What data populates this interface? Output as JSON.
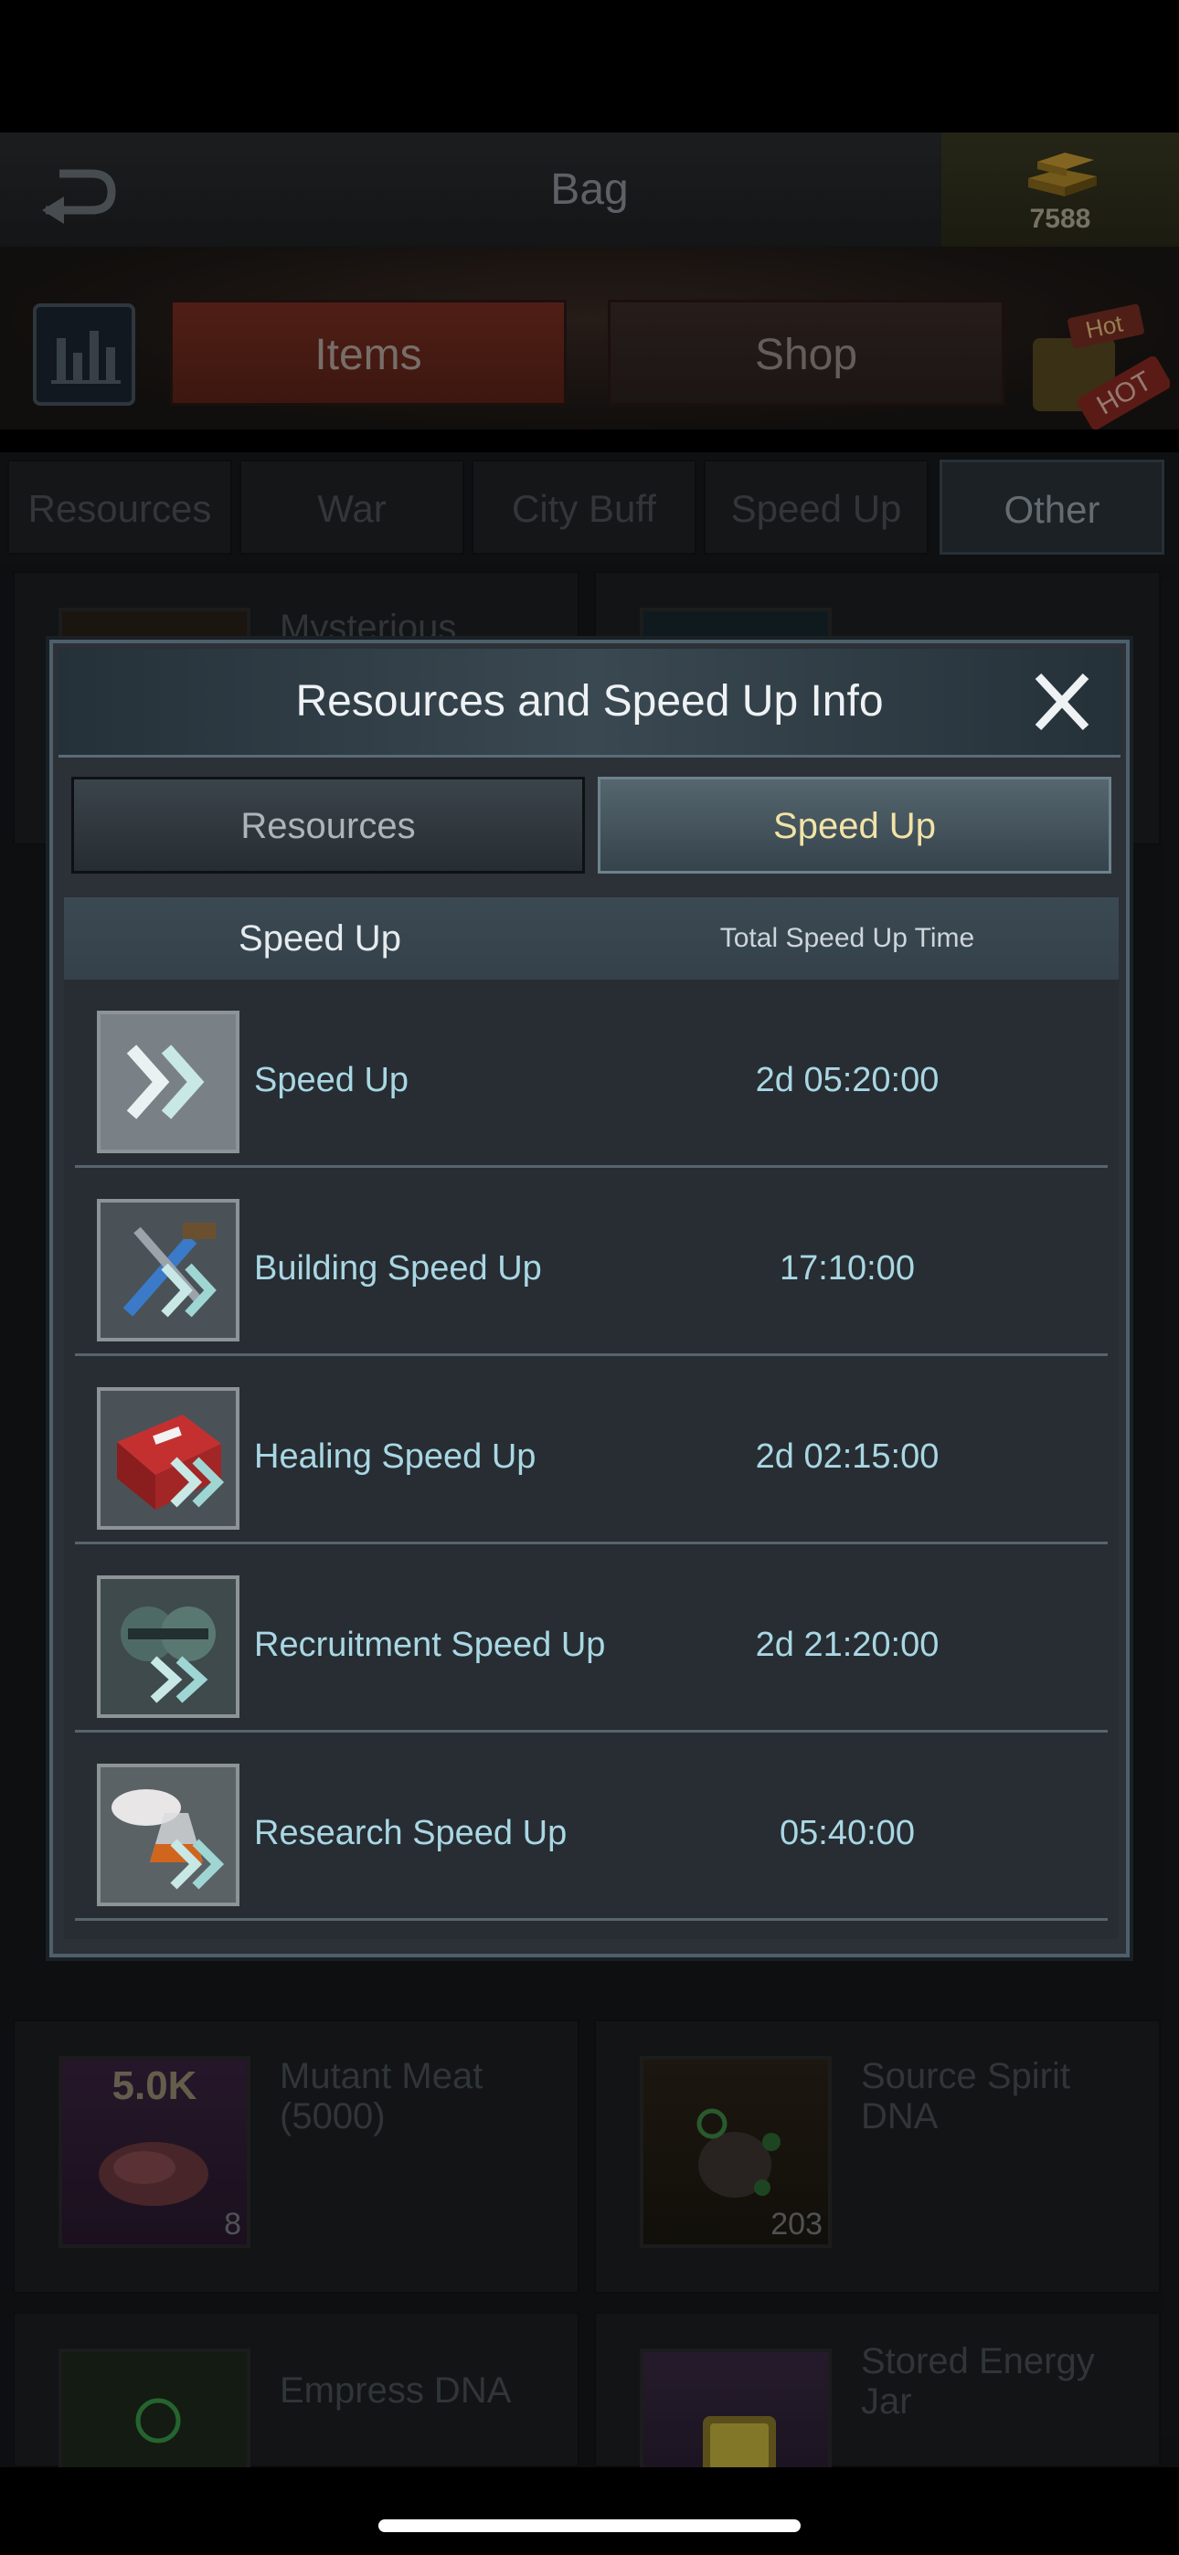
{
  "header": {
    "title": "Bag",
    "gold": "7588"
  },
  "main_tabs": [
    {
      "label": "Items"
    },
    {
      "label": "Shop"
    }
  ],
  "hot_badge": [
    "Hot",
    "HOT"
  ],
  "sub_tabs": [
    {
      "label": "Resources"
    },
    {
      "label": "War"
    },
    {
      "label": "City Buff"
    },
    {
      "label": "Speed Up"
    },
    {
      "label": "Other"
    }
  ],
  "items": [
    {
      "name": "Mysterious",
      "count": "",
      "qty_label": ""
    },
    {
      "name": "Mutant Meat (5000)",
      "count": "8",
      "qty_label": "5.0K"
    },
    {
      "name": "Source Spirit DNA",
      "count": "203",
      "qty_label": ""
    },
    {
      "name": "Empress DNA",
      "count": "",
      "qty_label": ""
    },
    {
      "name": "Stored Energy Jar",
      "count": "",
      "qty_label": ""
    }
  ],
  "modal": {
    "title": "Resources and Speed Up Info",
    "tabs": [
      {
        "label": "Resources"
      },
      {
        "label": "Speed Up"
      }
    ],
    "active_tab": "Speed Up",
    "columns": [
      "Speed Up",
      "Total Speed Up Time"
    ],
    "rows": [
      {
        "label": "Speed Up",
        "time": "2d 05:20:00",
        "icon": "speed-up-icon"
      },
      {
        "label": "Building Speed Up",
        "time": "17:10:00",
        "icon": "building-speed-up-icon"
      },
      {
        "label": "Healing Speed Up",
        "time": "2d 02:15:00",
        "icon": "healing-speed-up-icon"
      },
      {
        "label": "Recruitment Speed Up",
        "time": "2d 21:20:00",
        "icon": "recruitment-speed-up-icon"
      },
      {
        "label": "Research Speed Up",
        "time": "05:40:00",
        "icon": "research-speed-up-icon"
      }
    ]
  },
  "colors": {
    "accent_active_tab_text": "#f2e3a6",
    "row_text": "#a9d7e4",
    "items_tab": "#7a2f22"
  }
}
